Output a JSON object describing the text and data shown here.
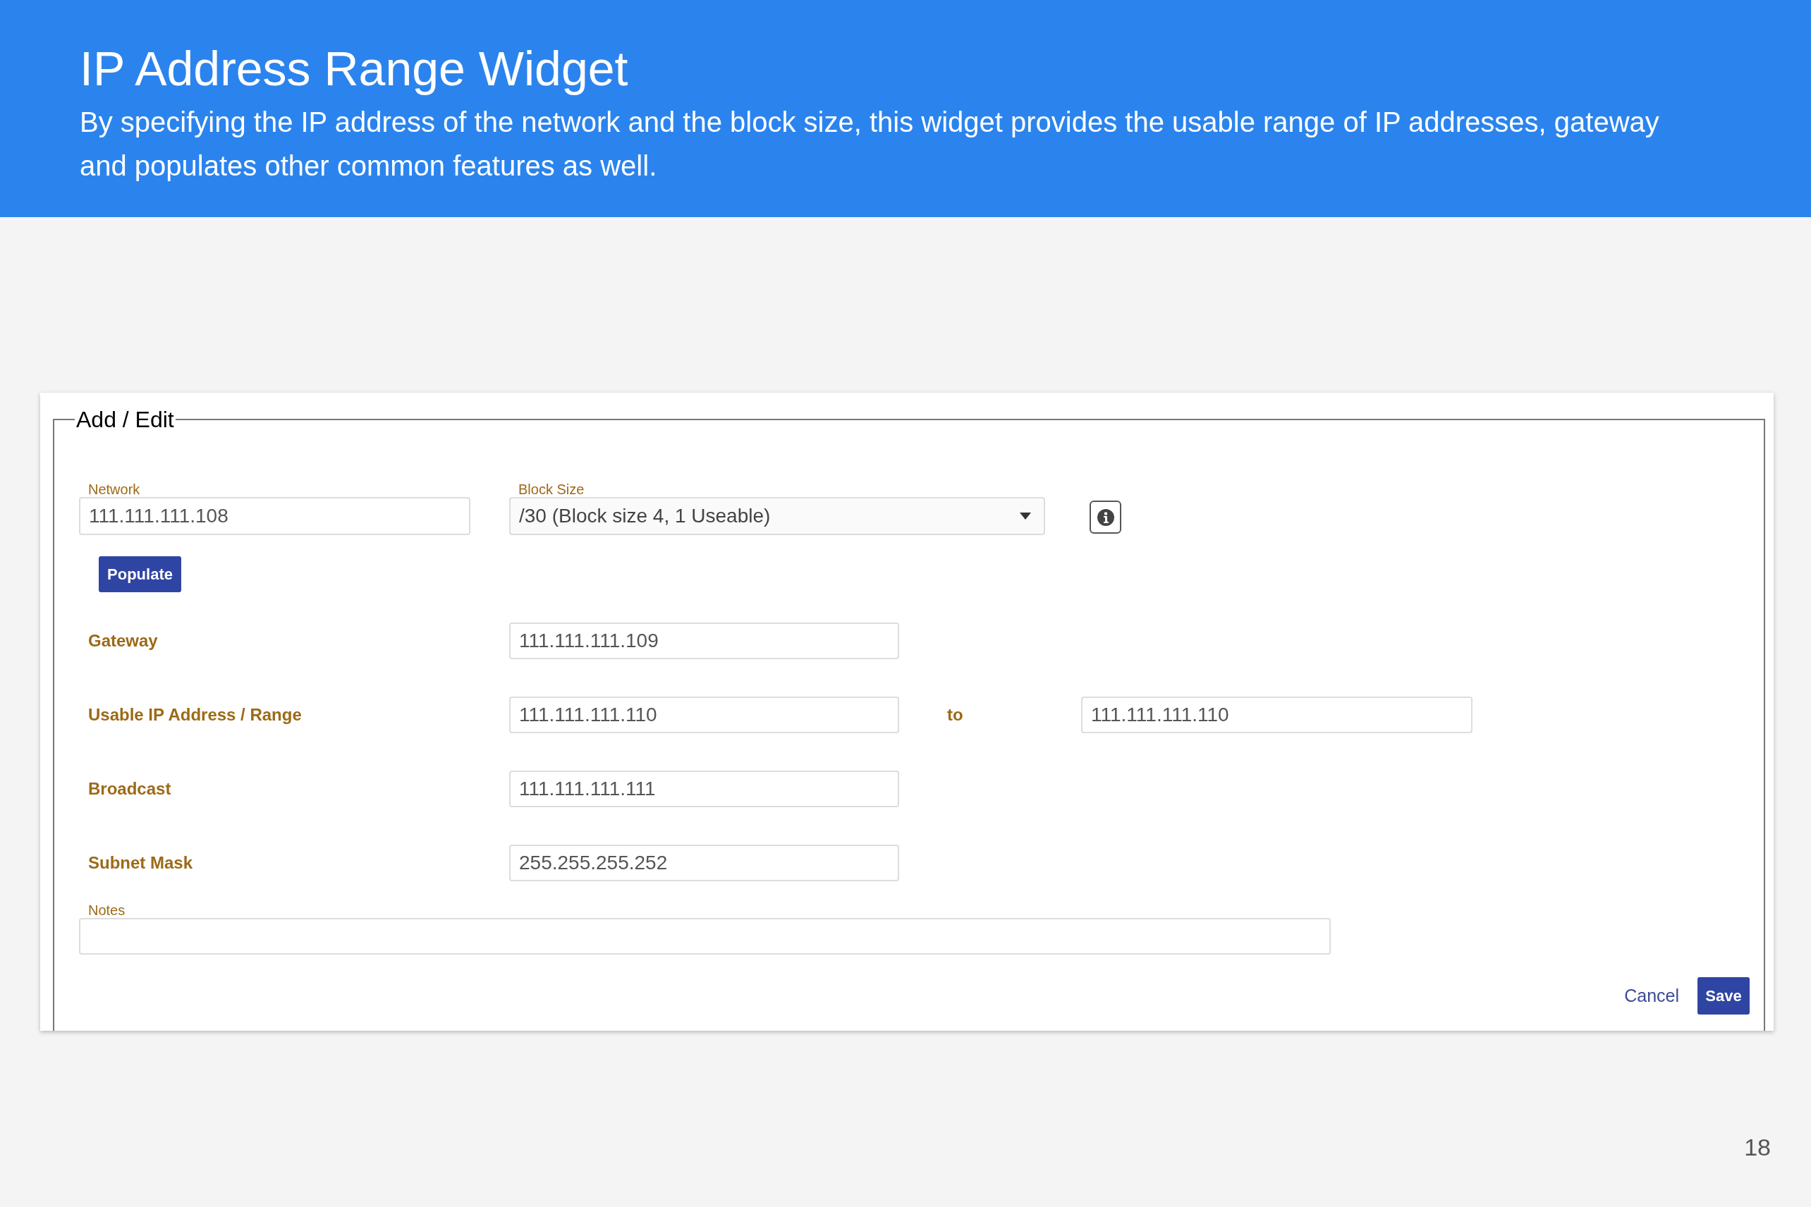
{
  "header": {
    "title": "IP Address Range Widget",
    "subtitle": "By specifying the IP address of the network and the block size, this widget provides the usable range of IP addresses, gateway and populates other common features as well."
  },
  "form": {
    "legend": "Add / Edit",
    "network": {
      "label": "Network",
      "value": "111.111.111.108"
    },
    "block_size": {
      "label": "Block Size",
      "value": "/30 (Block size 4, 1 Useable)"
    },
    "populate_button": "Populate",
    "rows": [
      {
        "label": "Gateway",
        "value": "111.111.111.109"
      },
      {
        "label": "Usable IP Address / Range",
        "value": "111.111.111.110",
        "to_label": "to",
        "value_end": "111.111.111.110"
      },
      {
        "label": "Broadcast",
        "value": "111.111.111.111"
      },
      {
        "label": "Subnet Mask",
        "value": "255.255.255.252"
      }
    ],
    "notes": {
      "label": "Notes"
    },
    "cancel_button": "Cancel",
    "save_button": "Save"
  },
  "page_number": "18"
}
